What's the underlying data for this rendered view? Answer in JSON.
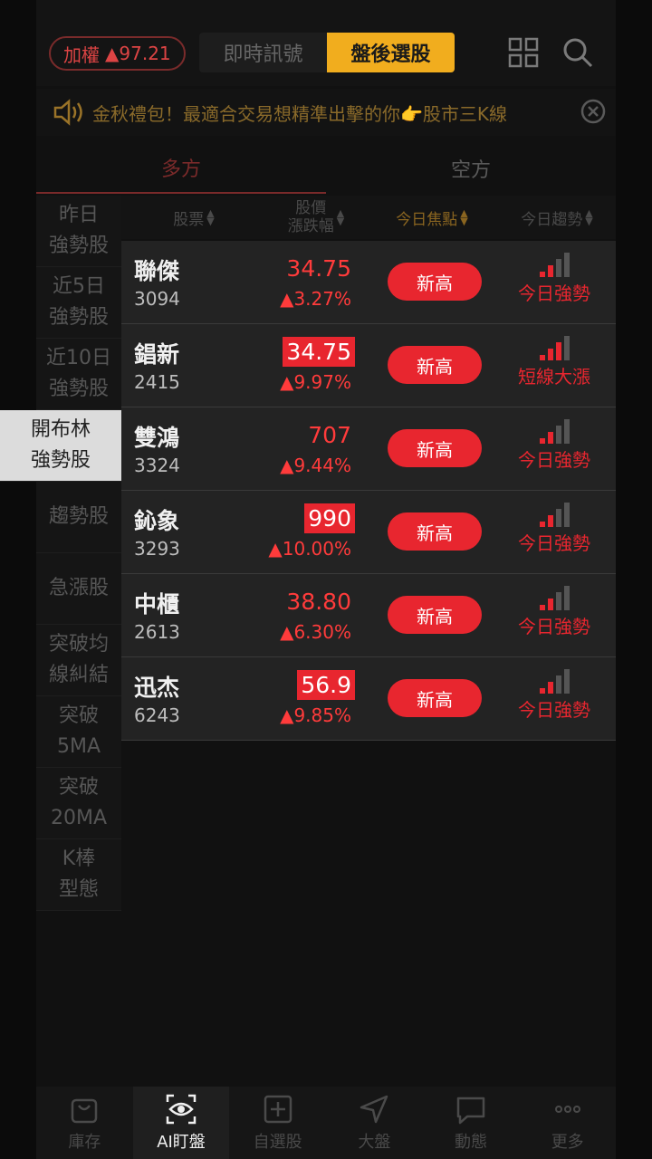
{
  "header": {
    "index_label": "加權",
    "index_value": "▲97.21",
    "tabs": [
      {
        "label": "即時訊號",
        "active": false
      },
      {
        "label": "盤後選股",
        "active": true
      }
    ],
    "icons": [
      "grid-icon",
      "search-icon"
    ]
  },
  "marquee": {
    "text": "金秋禮包！最適合交易想精準出擊的你👉股市三K線",
    "icons": [
      "speaker-icon",
      "close-circle-icon"
    ]
  },
  "direction_tabs": [
    {
      "label": "多方",
      "active": true
    },
    {
      "label": "空方",
      "active": false
    }
  ],
  "categories": [
    {
      "label": "昨日\n強勢股",
      "active": false
    },
    {
      "label": "近5日\n強勢股",
      "active": false
    },
    {
      "label": "近10日\n強勢股",
      "active": false
    },
    {
      "label": "開布林\n強勢股",
      "active": true
    },
    {
      "label": "趨勢股",
      "active": false
    },
    {
      "label": "急漲股",
      "active": false
    },
    {
      "label": "突破均\n線糾結",
      "active": false
    },
    {
      "label": "突破\n5MA",
      "active": false
    },
    {
      "label": "突破\n20MA",
      "active": false
    },
    {
      "label": "K棒\n型態",
      "active": false
    }
  ],
  "table": {
    "columns": {
      "stock": "股票",
      "price_line1": "股價",
      "price_line2": "漲跌幅",
      "focus": "今日焦點",
      "trend": "今日趨勢"
    },
    "rows": [
      {
        "name": "聯傑",
        "code": "3094",
        "price": "34.75",
        "change": "▲3.27%",
        "highlight": false,
        "focus": "新高",
        "trend": "今日強勢",
        "strength": 2
      },
      {
        "name": "錩新",
        "code": "2415",
        "price": "34.75",
        "change": "▲9.97%",
        "highlight": true,
        "focus": "新高",
        "trend": "短線大漲",
        "strength": 3
      },
      {
        "name": "雙鴻",
        "code": "3324",
        "price": "707",
        "change": "▲9.44%",
        "highlight": false,
        "focus": "新高",
        "trend": "今日強勢",
        "strength": 2
      },
      {
        "name": "鈊象",
        "code": "3293",
        "price": "990",
        "change": "▲10.00%",
        "highlight": true,
        "focus": "新高",
        "trend": "今日強勢",
        "strength": 2
      },
      {
        "name": "中櫃",
        "code": "2613",
        "price": "38.80",
        "change": "▲6.30%",
        "highlight": false,
        "focus": "新高",
        "trend": "今日強勢",
        "strength": 2
      },
      {
        "name": "迅杰",
        "code": "6243",
        "price": "56.9",
        "change": "▲9.85%",
        "highlight": true,
        "focus": "新高",
        "trend": "今日強勢",
        "strength": 2
      }
    ]
  },
  "bottom_nav": [
    {
      "label": "庫存",
      "icon": "bag-icon",
      "active": false
    },
    {
      "label": "AI盯盤",
      "icon": "eye-scan-icon",
      "active": true
    },
    {
      "label": "自選股",
      "icon": "plus-square-icon",
      "active": false
    },
    {
      "label": "大盤",
      "icon": "navigation-icon",
      "active": false
    },
    {
      "label": "動態",
      "icon": "chat-icon",
      "active": false
    },
    {
      "label": "更多",
      "icon": "more-icon",
      "active": false
    }
  ],
  "colors": {
    "accent": "#f1ad1e",
    "up_red": "#e8262f",
    "background": "#111111"
  }
}
